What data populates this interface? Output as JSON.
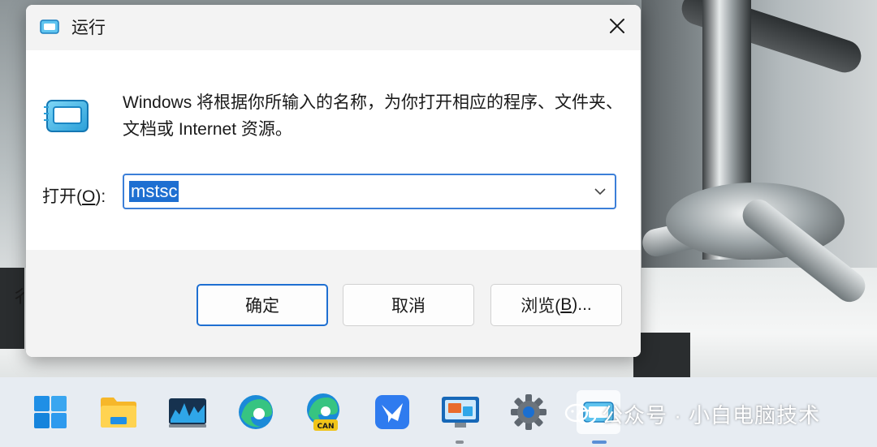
{
  "dialog": {
    "title": "运行",
    "description": "Windows 将根据你所输入的名称，为你打开相应的程序、文件夹、文档或 Internet 资源。",
    "open_label_prefix": "打开(",
    "open_label_key": "O",
    "open_label_suffix": "):",
    "open_value": "mstsc",
    "ok_label": "确定",
    "cancel_label": "取消",
    "browse_label_prefix": "浏览(",
    "browse_label_key": "B",
    "browse_label_suffix": ")...",
    "accent_color": "#1e6fd1"
  },
  "desktop": {
    "partial_text": "彳"
  },
  "taskbar": {
    "items": [
      {
        "icon": "windows-start-icon"
      },
      {
        "icon": "file-explorer-icon"
      },
      {
        "icon": "resource-monitor-icon"
      },
      {
        "icon": "edge-icon"
      },
      {
        "icon": "edge-canary-icon",
        "badge": "CAN"
      },
      {
        "icon": "feishu-icon"
      },
      {
        "icon": "remote-desktop-icon"
      },
      {
        "icon": "settings-gear-icon"
      },
      {
        "icon": "run-app-icon"
      }
    ]
  },
  "watermark": {
    "text": "公众号 · 小白电脑技术"
  }
}
